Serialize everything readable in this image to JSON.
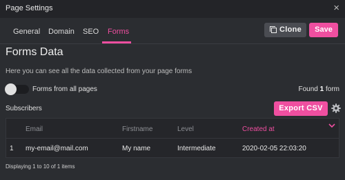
{
  "window": {
    "title": "Page Settings",
    "close_glyph": "×"
  },
  "tabs": [
    {
      "label": "General",
      "active": false
    },
    {
      "label": "Domain",
      "active": false
    },
    {
      "label": "SEO",
      "active": false
    },
    {
      "label": "Forms",
      "active": true
    }
  ],
  "toolbar": {
    "clone_label": "Clone",
    "clone_icon": "clone-icon",
    "save_label": "Save"
  },
  "page": {
    "heading": "Forms Data",
    "description": "Here you can see all the data collected from your page forms"
  },
  "filters": {
    "all_pages_toggle_label": "Forms from all pages",
    "all_pages_toggle_on": false,
    "found_prefix": "Found",
    "found_count": "1",
    "found_suffix": "form"
  },
  "subscribers": {
    "label": "Subscribers",
    "export_label": "Export CSV",
    "settings_icon": "gear-icon"
  },
  "table": {
    "columns": [
      "",
      "Email",
      "Firstname",
      "Level",
      "Created at"
    ],
    "sorted_column": "Created at",
    "sort_direction": "descending",
    "rows": [
      {
        "index": "1",
        "email": "my-email@mail.com",
        "firstname": "My name",
        "level": "Intermediate",
        "created_at": "2020-02-05 22:03:20"
      }
    ]
  },
  "pagination": {
    "summary": "Displaying 1 to 10 of 1 items"
  },
  "colors": {
    "accent": "#ef4fa0",
    "background": "#2b2d31",
    "titlebar": "#232428"
  }
}
